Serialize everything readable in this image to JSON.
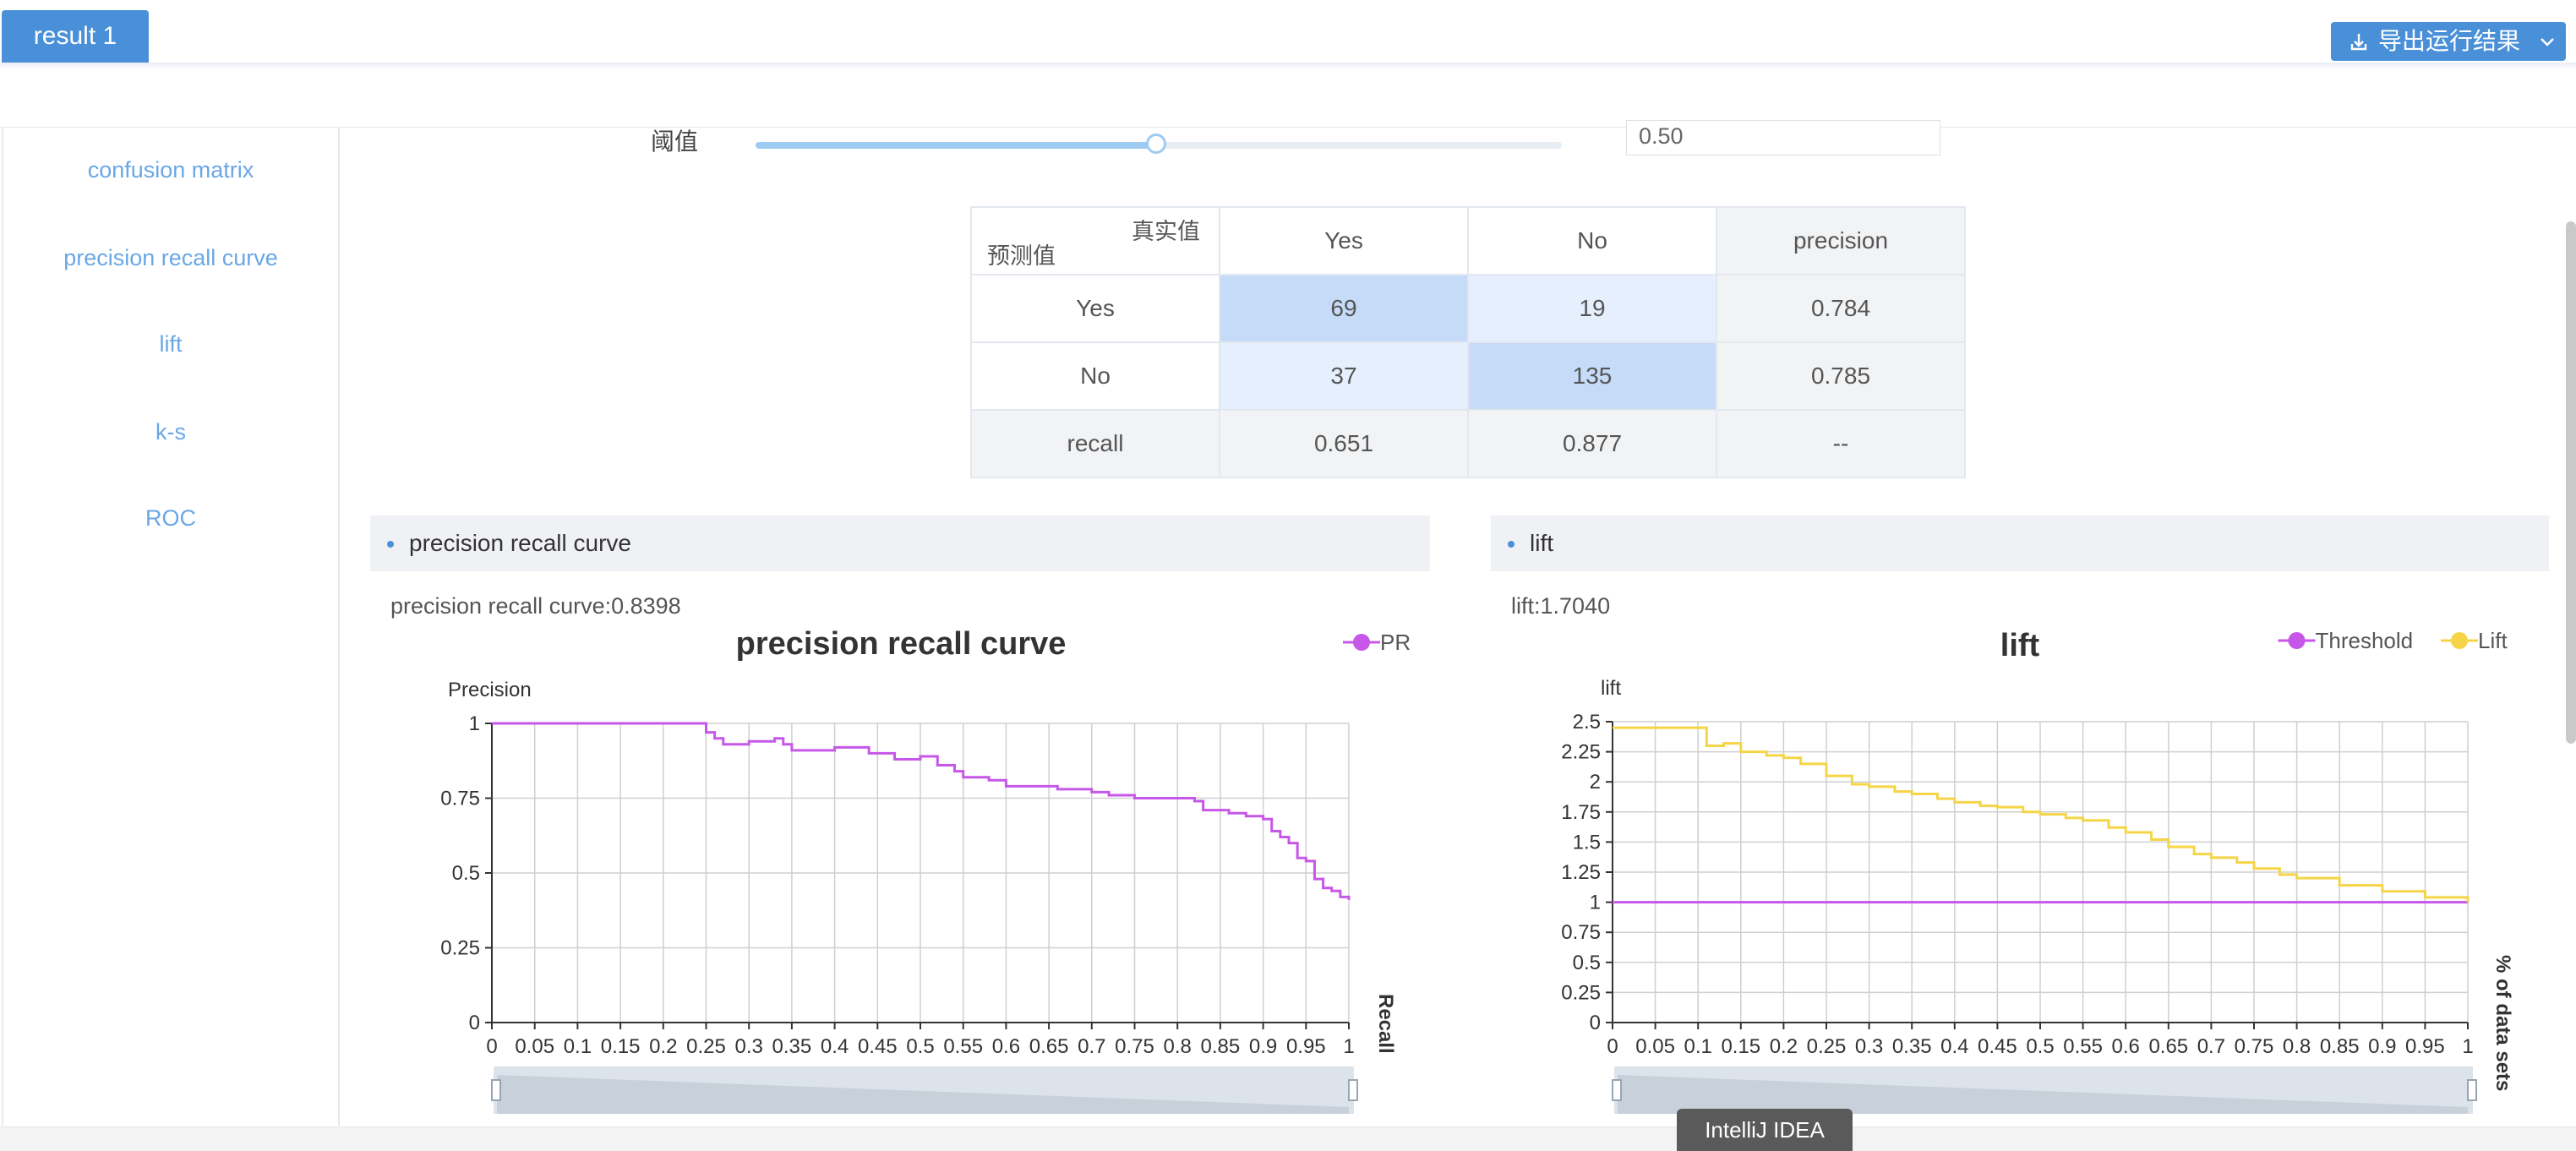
{
  "tab": {
    "label": "result 1"
  },
  "export": {
    "label": "导出运行结果",
    "icon": "download-icon"
  },
  "sidebar": {
    "items": [
      {
        "label": "confusion matrix"
      },
      {
        "label": "precision recall curve"
      },
      {
        "label": "lift"
      },
      {
        "label": "k-s"
      },
      {
        "label": "ROC"
      }
    ]
  },
  "threshold": {
    "label": "阈值",
    "value": "0.50",
    "slider_value": 0.5
  },
  "confusion_matrix": {
    "corner_actual": "真实值",
    "corner_predicted": "预测值",
    "columns": [
      "Yes",
      "No",
      "precision"
    ],
    "rows": [
      {
        "label": "Yes",
        "cells": [
          "69",
          "19",
          "0.784"
        ]
      },
      {
        "label": "No",
        "cells": [
          "37",
          "135",
          "0.785"
        ]
      },
      {
        "label": "recall",
        "cells": [
          "0.651",
          "0.877",
          "--"
        ]
      }
    ]
  },
  "panels": {
    "pr": {
      "header": "precision recall curve",
      "metric": "precision recall curve:0.8398"
    },
    "lift": {
      "header": "lift",
      "metric": "lift:1.7040"
    }
  },
  "chart_data": [
    {
      "type": "line",
      "title": "precision recall curve",
      "xlabel": "Recall",
      "ylabel": "Precision",
      "xlim": [
        0,
        1
      ],
      "ylim": [
        0,
        1
      ],
      "x_ticks": [
        "0",
        "0.05",
        "0.1",
        "0.15",
        "0.2",
        "0.25",
        "0.3",
        "0.35",
        "0.4",
        "0.45",
        "0.5",
        "0.55",
        "0.6",
        "0.65",
        "0.7",
        "0.75",
        "0.8",
        "0.85",
        "0.9",
        "0.95",
        "1"
      ],
      "y_ticks": [
        "0",
        "0.25",
        "0.5",
        "0.75",
        "1"
      ],
      "legend": "top-right",
      "grid": true,
      "series": [
        {
          "name": "PR",
          "color": "#c657e8",
          "x": [
            0,
            0.05,
            0.1,
            0.15,
            0.2,
            0.245,
            0.25,
            0.26,
            0.27,
            0.3,
            0.33,
            0.34,
            0.35,
            0.38,
            0.4,
            0.43,
            0.44,
            0.46,
            0.47,
            0.5,
            0.52,
            0.54,
            0.55,
            0.58,
            0.6,
            0.62,
            0.65,
            0.66,
            0.7,
            0.72,
            0.75,
            0.78,
            0.8,
            0.82,
            0.83,
            0.86,
            0.88,
            0.9,
            0.91,
            0.92,
            0.93,
            0.94,
            0.95,
            0.96,
            0.97,
            0.98,
            0.99,
            1
          ],
          "values": [
            1,
            1,
            1,
            1,
            1,
            1,
            0.97,
            0.95,
            0.93,
            0.94,
            0.95,
            0.93,
            0.91,
            0.91,
            0.92,
            0.92,
            0.9,
            0.9,
            0.88,
            0.89,
            0.86,
            0.84,
            0.82,
            0.81,
            0.79,
            0.79,
            0.79,
            0.78,
            0.77,
            0.76,
            0.75,
            0.75,
            0.75,
            0.74,
            0.71,
            0.7,
            0.69,
            0.68,
            0.64,
            0.62,
            0.6,
            0.55,
            0.54,
            0.48,
            0.45,
            0.44,
            0.42,
            0.41
          ]
        }
      ]
    },
    {
      "type": "line",
      "title": "lift",
      "xlabel": "% of data sets",
      "ylabel": "lift",
      "xlim": [
        0,
        1
      ],
      "ylim": [
        0,
        2.5
      ],
      "x_ticks": [
        "0",
        "0.05",
        "0.1",
        "0.15",
        "0.2",
        "0.25",
        "0.3",
        "0.35",
        "0.4",
        "0.45",
        "0.5",
        "0.55",
        "0.6",
        "0.65",
        "0.7",
        "0.75",
        "0.8",
        "0.85",
        "0.9",
        "0.95",
        "1"
      ],
      "y_ticks": [
        "0",
        "0.25",
        "0.5",
        "0.75",
        "1",
        "1.25",
        "1.5",
        "1.75",
        "2",
        "2.25",
        "2.5"
      ],
      "legend": "top-right",
      "grid": true,
      "series": [
        {
          "name": "Threshold",
          "color": "#c657e8",
          "x": [
            0,
            1
          ],
          "values": [
            1,
            1
          ]
        },
        {
          "name": "Lift",
          "color": "#f5d547",
          "x": [
            0,
            0.05,
            0.1,
            0.11,
            0.13,
            0.15,
            0.18,
            0.2,
            0.22,
            0.25,
            0.28,
            0.3,
            0.33,
            0.35,
            0.38,
            0.4,
            0.43,
            0.45,
            0.48,
            0.5,
            0.53,
            0.55,
            0.58,
            0.6,
            0.63,
            0.65,
            0.68,
            0.7,
            0.73,
            0.75,
            0.78,
            0.8,
            0.85,
            0.9,
            0.95,
            1
          ],
          "values": [
            2.45,
            2.45,
            2.45,
            2.3,
            2.32,
            2.25,
            2.22,
            2.2,
            2.15,
            2.05,
            1.98,
            1.96,
            1.92,
            1.9,
            1.86,
            1.83,
            1.8,
            1.79,
            1.75,
            1.73,
            1.7,
            1.68,
            1.62,
            1.58,
            1.52,
            1.46,
            1.4,
            1.37,
            1.33,
            1.28,
            1.23,
            1.2,
            1.14,
            1.09,
            1.04,
            1.0
          ]
        }
      ]
    }
  ],
  "ide_tag": "IntelliJ IDEA"
}
